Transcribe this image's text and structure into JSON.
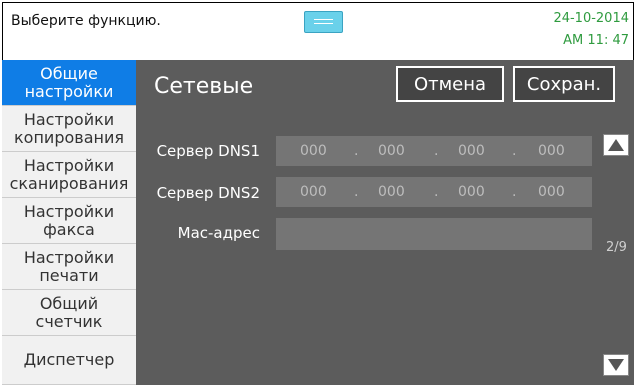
{
  "statusbar": {
    "prompt": "Выберите функцию.",
    "date": "24-10-2014",
    "time": "AM 11: 47"
  },
  "sidebar": {
    "items": [
      {
        "label": "Общие\nнастройки",
        "active": true
      },
      {
        "label": "Настройки\nкопирования",
        "active": false
      },
      {
        "label": "Настройки\nсканирования",
        "active": false
      },
      {
        "label": "Настройки\nфакса",
        "active": false
      },
      {
        "label": "Настройки\nпечати",
        "active": false
      },
      {
        "label": "Общий\nсчетчик",
        "active": false
      },
      {
        "label": "Диспетчер",
        "active": false
      }
    ]
  },
  "main": {
    "title": "Сетевые",
    "cancel_label": "Отмена",
    "save_label": "Сохран.",
    "dns1": {
      "label": "Сервер DNS1",
      "octets": [
        "000",
        "000",
        "000",
        "000"
      ]
    },
    "dns2": {
      "label": "Сервер DNS2",
      "octets": [
        "000",
        "000",
        "000",
        "000"
      ]
    },
    "mac": {
      "label": "Mac-адрес",
      "value": ""
    },
    "page_indicator": "2/9"
  },
  "colors": {
    "accent": "#0f7de6",
    "panel": "#5c5c5c",
    "datetime": "#2f9b3f",
    "handle": "#6ad1ea"
  }
}
